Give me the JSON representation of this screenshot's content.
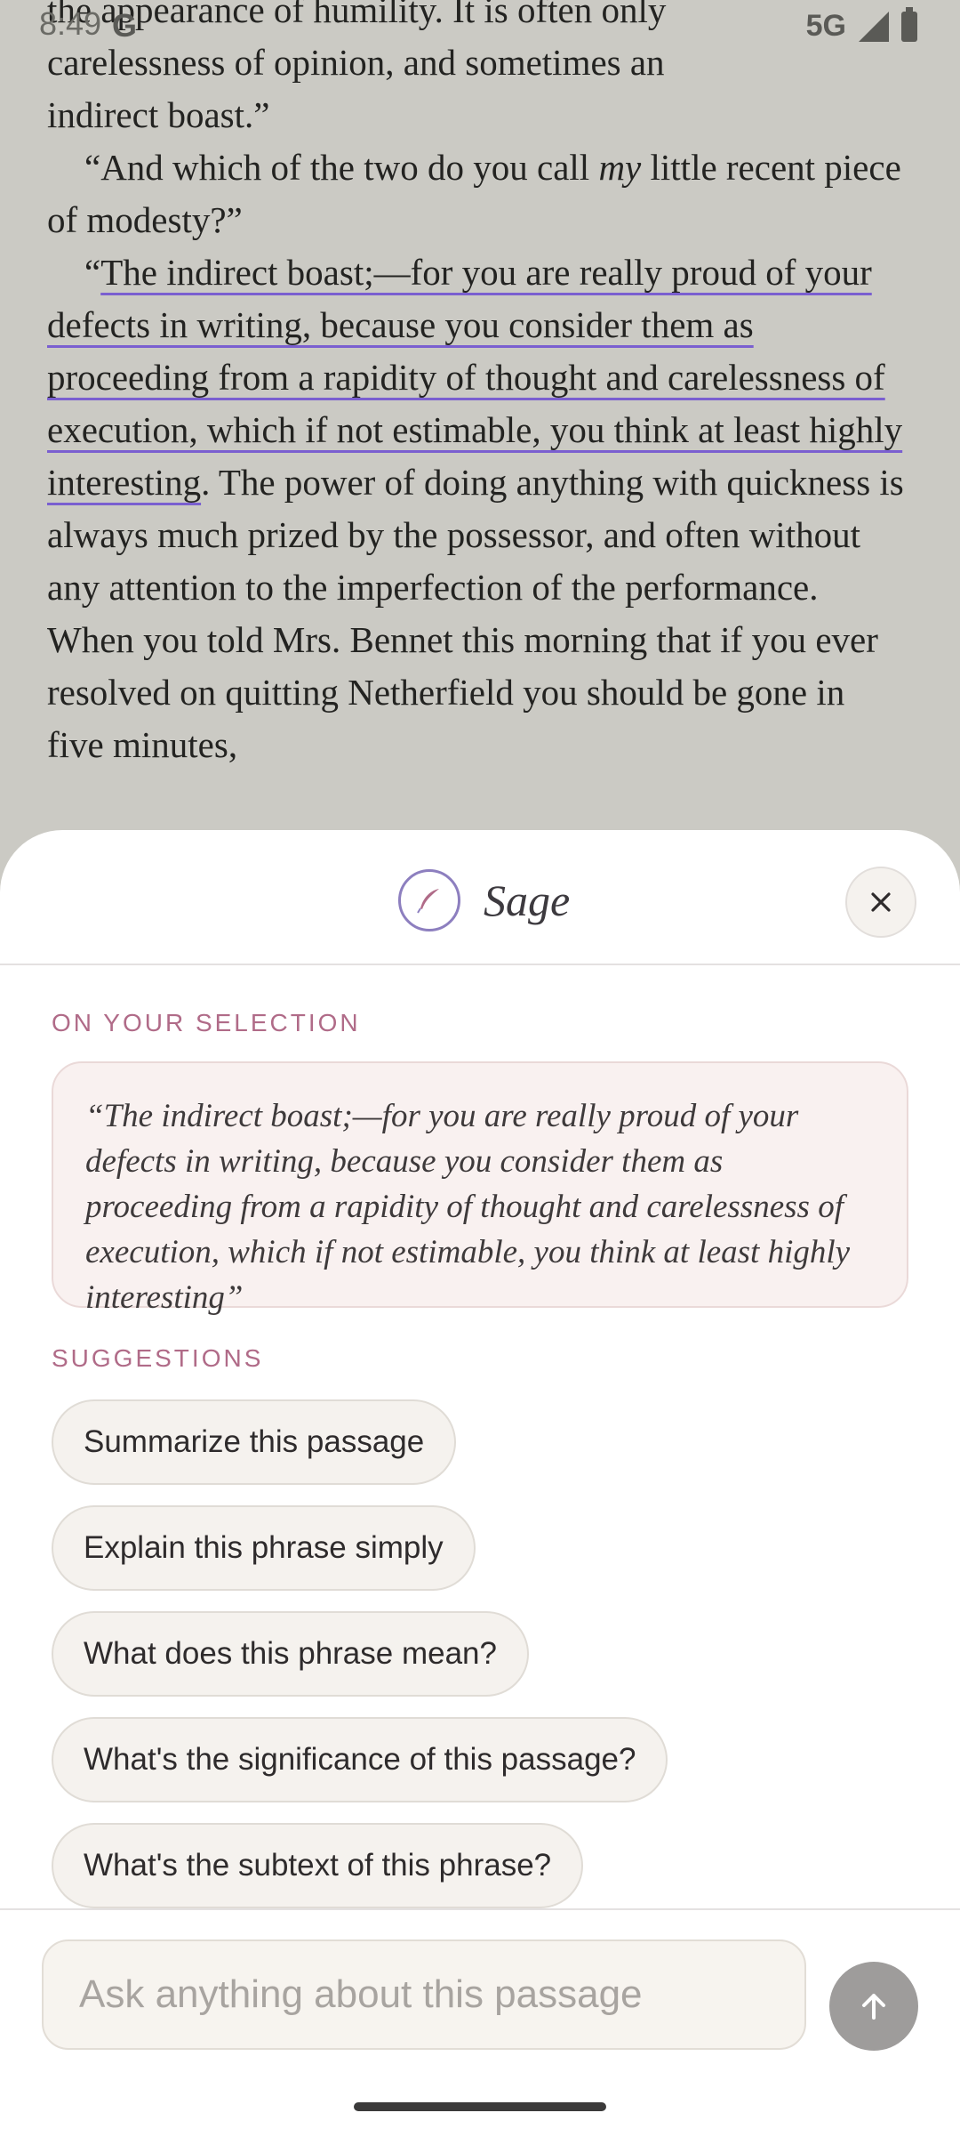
{
  "status_bar": {
    "time": "8:49",
    "g_icon": "google-g-icon",
    "network": "5G",
    "icons": [
      "signal-icon",
      "battery-icon"
    ]
  },
  "reader": {
    "lines": [
      "the appearance of humility. It is often only",
      "carelessness of opinion, and sometimes an",
      "indirect boast.”"
    ],
    "para2_pre": "“And which of the two do you call ",
    "para2_em": "my",
    "para2_post": " little recent piece of modesty?”",
    "para3_open": "“",
    "para3_highlight": "The indirect boast;—for you are really proud of your defects in writing, because you consider them as proceeding from a rapidity of thought and carelessness of execution, which if not estimable, you think at least highly interesting",
    "para3_rest": ". The power of doing anything with quickness is always much prized by the possessor, and often without any attention to the imperfection of the performance. When you told Mrs. Bennet this morning that if you ever resolved on quitting Netherfield you should be gone in five minutes,",
    "highlight_color": "#7a5fd0"
  },
  "sheet": {
    "brand_name": "Sage",
    "brand_icon": "feather-icon",
    "close_icon": "close-icon",
    "selection_label": "ON YOUR SELECTION",
    "selection_quote": "“The indirect boast;—for you are really proud of your defects in writing, because you consider them as proceeding from a rapidity of thought and carelessness of execution, which if not estimable, you think at least highly interesting”",
    "suggestions_label": "SUGGESTIONS",
    "suggestions": [
      "Summarize this passage",
      "Explain this phrase simply",
      "What does this phrase mean?",
      "What's the significance of this passage?",
      "What's the subtext of this phrase?"
    ],
    "input_placeholder": "Ask anything about this passage",
    "send_icon": "arrow-up-icon",
    "accent_color": "#b06b88"
  }
}
